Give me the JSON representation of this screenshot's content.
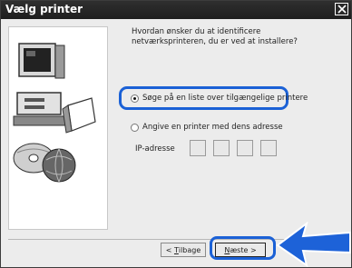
{
  "dialog": {
    "title": "Vælg printer",
    "question": "Hvordan ønsker du at identificere netværksprinteren, du er ved at installere?",
    "option_list_label": "Søge på en liste over tilgængelige printere",
    "option_address_label": "Angive en printer med dens adresse",
    "ip_label": "IP-adresse",
    "ip_octets": [
      "",
      "",
      "",
      ""
    ],
    "back_prefix": "< ",
    "back_mnemonic": "T",
    "back_rest": "ilbage",
    "next_mnemonic": "N",
    "next_rest": "æste >",
    "selected_option": "list"
  },
  "colors": {
    "highlight": "#1b61d6",
    "arrow": "#1d62d8"
  },
  "icons": [
    "close-icon",
    "computer-illustration-icon",
    "arrow-pointer-icon"
  ]
}
